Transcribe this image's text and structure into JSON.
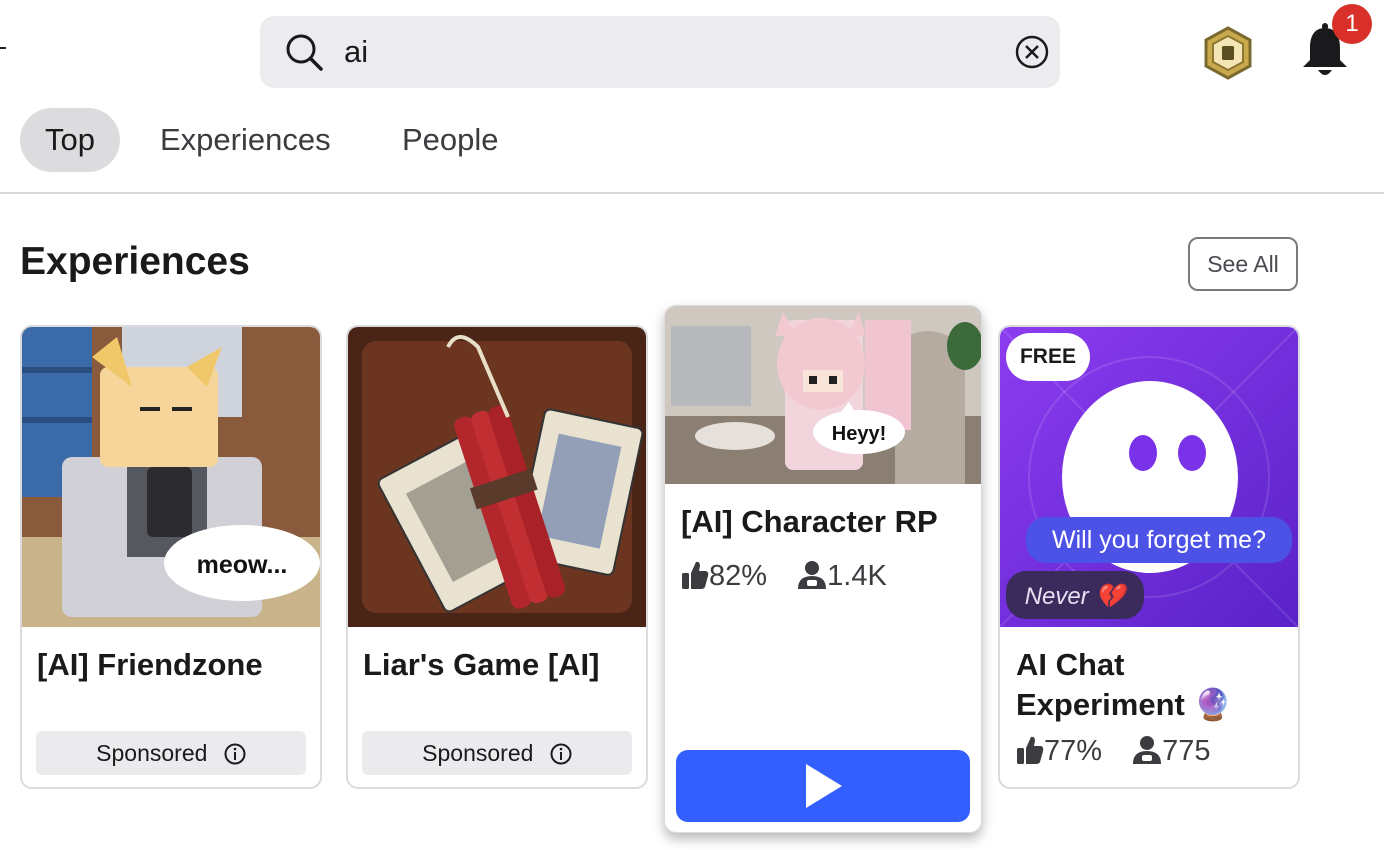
{
  "search": {
    "query": "ai"
  },
  "notifications": {
    "count": "1"
  },
  "tabs": [
    {
      "label": "Top",
      "active": true
    },
    {
      "label": "Experiences",
      "active": false
    },
    {
      "label": "People",
      "active": false
    }
  ],
  "section": {
    "title": "Experiences",
    "see_all": "See All"
  },
  "cards": [
    {
      "title": "[AI] Friendzone",
      "sponsored": "Sponsored",
      "bubble": "meow..."
    },
    {
      "title": "Liar's Game [AI]",
      "sponsored": "Sponsored"
    },
    {
      "title": "[AI] Character RP",
      "rating": "82%",
      "players": "1.4K",
      "bubble": "Heyy!"
    },
    {
      "title": "AI Chat Experiment 🔮",
      "rating": "77%",
      "players": "775",
      "badge": "FREE",
      "bubble1": "Will you forget me?",
      "bubble2": "Never 💔"
    }
  ],
  "colors": {
    "play": "#335fff",
    "badge": "#d9302a",
    "purple": "#7a32e8"
  },
  "icons": [
    "search-icon",
    "clear-icon",
    "robux-icon",
    "bell-icon",
    "info-icon",
    "thumbs-up-icon",
    "players-icon",
    "play-icon"
  ]
}
